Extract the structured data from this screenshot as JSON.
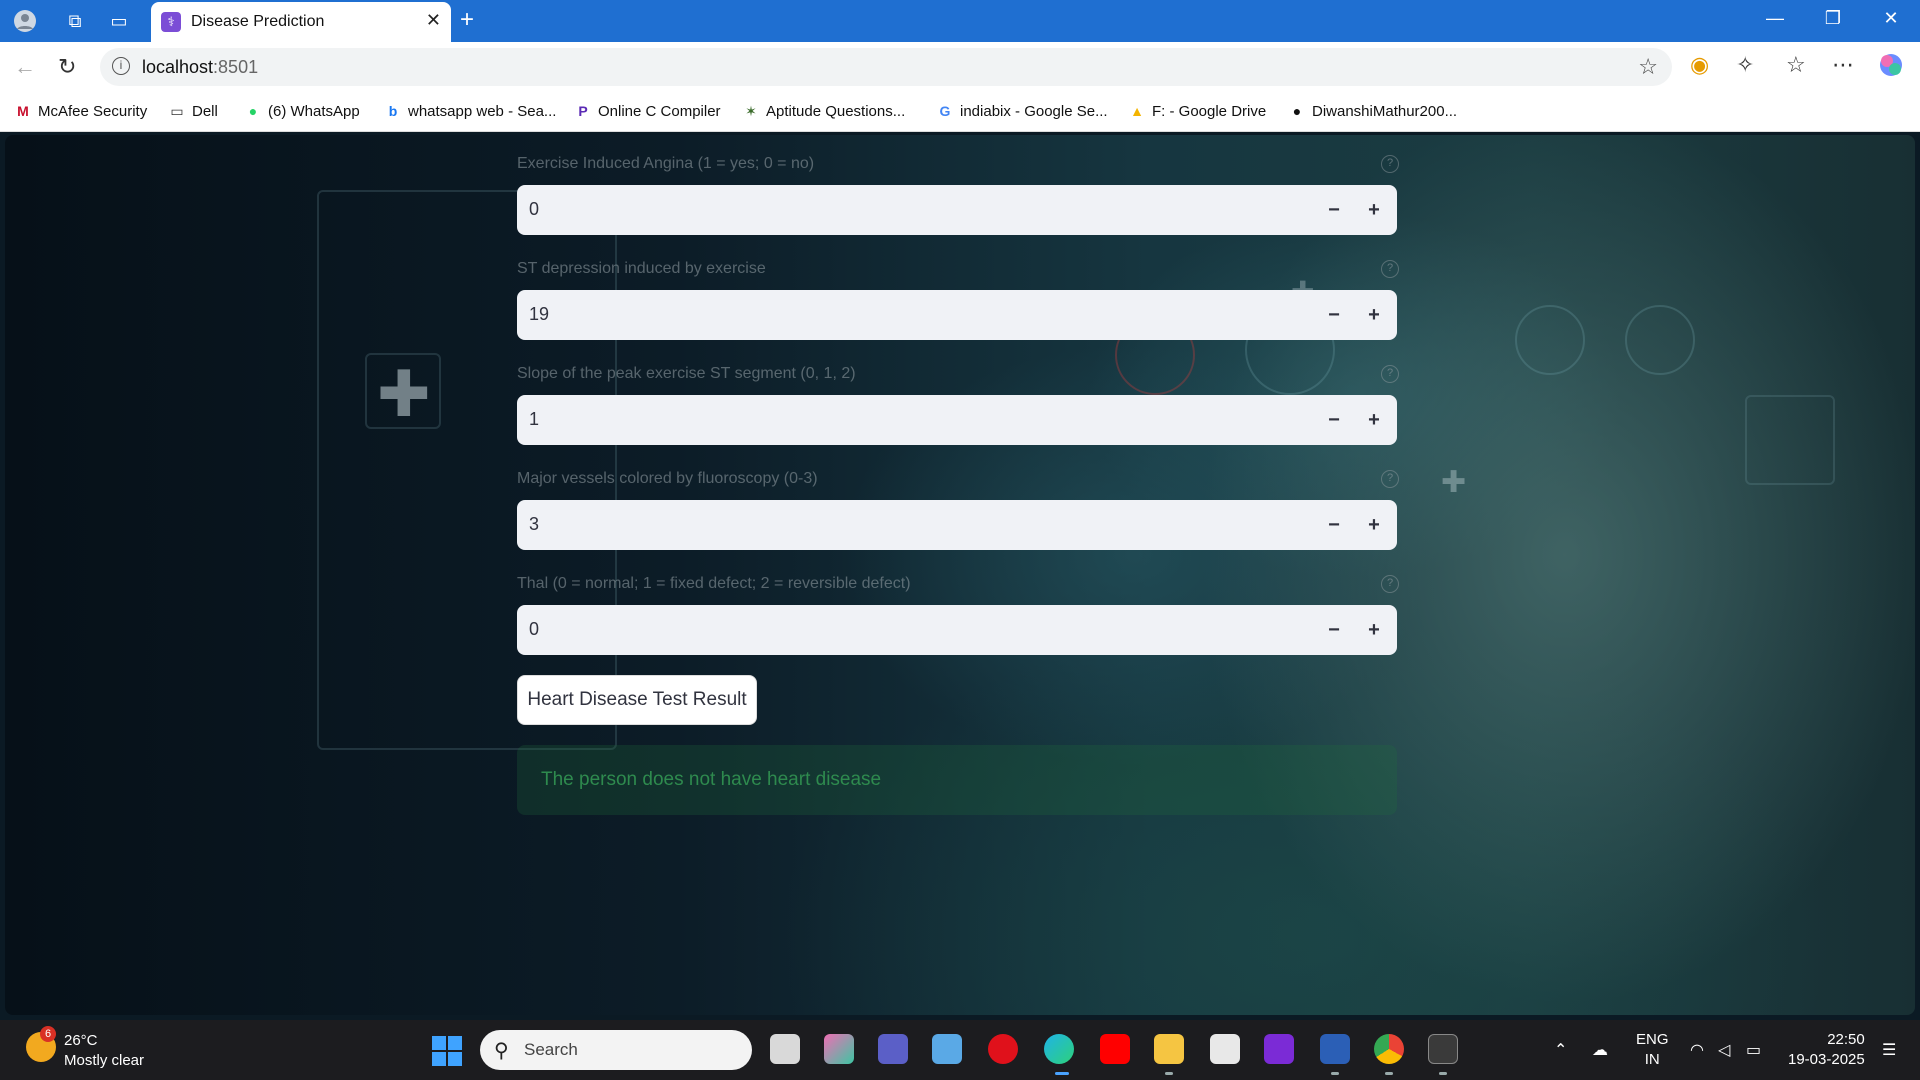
{
  "browser": {
    "tab_title": "Disease Prediction",
    "address_host": "localhost",
    "address_port": ":8501",
    "bookmarks": [
      {
        "label": "McAfee Security",
        "icon": "mcafee-icon"
      },
      {
        "label": "Dell",
        "icon": "folder-icon"
      },
      {
        "label": "(6) WhatsApp",
        "icon": "whatsapp-icon"
      },
      {
        "label": "whatsapp web - Sea...",
        "icon": "bing-icon"
      },
      {
        "label": "Online C Compiler",
        "icon": "compiler-icon"
      },
      {
        "label": "Aptitude Questions...",
        "icon": "aptitude-icon"
      },
      {
        "label": "indiabix - Google Se...",
        "icon": "google-icon"
      },
      {
        "label": "F: - Google Drive",
        "icon": "drive-icon"
      },
      {
        "label": "DiwanshiMathur200...",
        "icon": "github-icon"
      }
    ]
  },
  "form": {
    "fields": [
      {
        "label": "Exercise Induced Angina (1 = yes; 0 = no)",
        "value": "0"
      },
      {
        "label": "ST depression induced by exercise",
        "value": "19"
      },
      {
        "label": "Slope of the peak exercise ST segment (0, 1, 2)",
        "value": "1"
      },
      {
        "label": "Major vessels colored by fluoroscopy (0-3)",
        "value": "3"
      },
      {
        "label": "Thal (0 = normal; 1 = fixed defect; 2 = reversible defect)",
        "value": "0"
      }
    ],
    "minus_label": "−",
    "plus_label": "+",
    "submit_label": "Heart Disease Test Result",
    "result_text": "The person does not have heart disease"
  },
  "taskbar": {
    "weather_badge": "6",
    "weather_temp": "26°C",
    "weather_desc": "Mostly clear",
    "search_placeholder": "Search",
    "lang_line1": "ENG",
    "lang_line2": "IN",
    "time": "22:50",
    "date": "19-03-2025"
  },
  "colors": {
    "browser_accent": "#1f6fd1",
    "success_text": "#2e8a4e",
    "input_bg": "#f0f2f6"
  }
}
